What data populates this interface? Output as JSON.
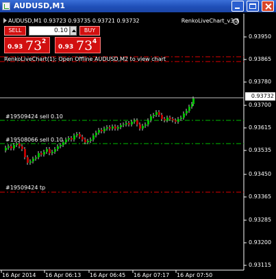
{
  "window": {
    "title": "AUDUSD,M1"
  },
  "header": {
    "quote_line": "AUDUSD,M1  0.93723 0.93735 0.93721 0.93732",
    "indicator": "RenkoLiveChart_v3.3"
  },
  "panel": {
    "sell_label": "SELL",
    "buy_label": "BUY",
    "lot": "0.10",
    "sell_quote": {
      "prefix": "0.93",
      "big": "73",
      "sup": "2"
    },
    "buy_quote": {
      "prefix": "0.93",
      "big": "73",
      "sup": "4"
    }
  },
  "message": "RenkoLiveChart(1): Open Offline AUDUSD,M2 to view chart",
  "trades": {
    "sell1": "#19509424 sell 0.10",
    "sell2": "#19508066 sell 0.10",
    "tp": "#19509424 tp"
  },
  "price_axis": {
    "labels": [
      "0.93950",
      "0.93865",
      "0.93780",
      "0.93700",
      "0.93615",
      "0.93535",
      "0.93450",
      "0.93365",
      "0.93285",
      "0.93200",
      "0.93115"
    ],
    "current": "0.93732"
  },
  "time_axis": {
    "labels": [
      "16 Apr 2014",
      "16 Apr 06:13",
      "16 Apr 06:45",
      "16 Apr 07:17",
      "16 Apr 07:50"
    ]
  },
  "colors": {
    "background": "#000000",
    "bull": "#00c000",
    "bear": "#c00000",
    "candle": "#c0c0c0",
    "entry_line": "#00c000",
    "tp_line": "#e00000"
  }
}
